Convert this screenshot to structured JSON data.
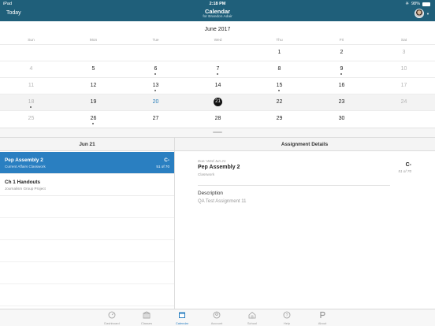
{
  "status": {
    "carrier": "iPad",
    "time": "2:18 PM",
    "battery": "98%",
    "battery_level": 0.98
  },
  "nav": {
    "today": "Today",
    "title": "Calendar",
    "subtitle": "for Brandon Adair"
  },
  "calendar": {
    "month": "June 2017",
    "weekdays": [
      "Sun",
      "Mon",
      "Tue",
      "Wed",
      "Thu",
      "Fri",
      "Sat"
    ],
    "weeks": [
      [
        {
          "d": ""
        },
        {
          "d": ""
        },
        {
          "d": ""
        },
        {
          "d": ""
        },
        {
          "d": "1"
        },
        {
          "d": "2"
        },
        {
          "d": "3",
          "m": 1
        }
      ],
      [
        {
          "d": "4",
          "m": 1
        },
        {
          "d": "5"
        },
        {
          "d": "6",
          "dot": 1
        },
        {
          "d": "7",
          "dot": 1
        },
        {
          "d": "8"
        },
        {
          "d": "9",
          "dot": 1
        },
        {
          "d": "10",
          "m": 1
        }
      ],
      [
        {
          "d": "11",
          "m": 1
        },
        {
          "d": "12"
        },
        {
          "d": "13",
          "dot": 1
        },
        {
          "d": "14"
        },
        {
          "d": "15",
          "dot": 1
        },
        {
          "d": "16"
        },
        {
          "d": "17",
          "m": 1
        }
      ],
      [
        {
          "d": "18",
          "m": 1,
          "dot": 1
        },
        {
          "d": "19"
        },
        {
          "d": "20",
          "today": 1
        },
        {
          "d": "21",
          "sel": 1
        },
        {
          "d": "22"
        },
        {
          "d": "23"
        },
        {
          "d": "24",
          "m": 1
        }
      ],
      [
        {
          "d": "25",
          "m": 1
        },
        {
          "d": "26",
          "dot": 1
        },
        {
          "d": "27"
        },
        {
          "d": "28"
        },
        {
          "d": "29"
        },
        {
          "d": "30"
        },
        {
          "d": ""
        }
      ]
    ]
  },
  "list": {
    "header": "Jun 21",
    "items": [
      {
        "title": "Pep Assembly 2",
        "subtitle": "Current Affairs Classwork",
        "grade": "C-",
        "score": "51 of 70",
        "active": true
      },
      {
        "title": "Ch 1 Handouts",
        "subtitle": "Journalism Group Project",
        "grade": "",
        "score": "",
        "active": false
      }
    ]
  },
  "details": {
    "header": "Assignment Details",
    "due": "Due: Wed Jun 21",
    "title": "Pep Assembly 2",
    "type": "Classwork",
    "grade": "C-",
    "score": "51 of 70",
    "description_label": "Description",
    "description": "QA Test Assignment 11"
  },
  "tabs": [
    {
      "label": "Dashboard",
      "icon": "dashboard-icon"
    },
    {
      "label": "Classes",
      "icon": "classes-icon"
    },
    {
      "label": "Calendar",
      "icon": "calendar-icon",
      "active": true
    },
    {
      "label": "Account",
      "icon": "account-icon"
    },
    {
      "label": "School",
      "icon": "school-icon"
    },
    {
      "label": "Help",
      "icon": "help-icon"
    },
    {
      "label": "About",
      "icon": "about-icon"
    }
  ],
  "colors": {
    "nav": "#1f5f7a",
    "accent": "#2a7fc1",
    "today": "#2a7fb8"
  }
}
